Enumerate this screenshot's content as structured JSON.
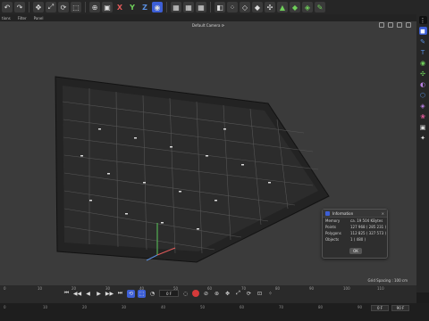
{
  "menubar": {
    "items": [
      "tions",
      "Filter",
      "Panel"
    ]
  },
  "toolbar": {
    "axis_x": "X",
    "axis_y": "Y",
    "axis_z": "Z"
  },
  "viewport": {
    "camera_label": "Default Camera ⟳",
    "grid_spacing": "Grid Spacing : 100 cm"
  },
  "info_dialog": {
    "title": "Information",
    "close": "✕",
    "rows": [
      {
        "key": "Memory",
        "value": "ca. 19 504 KBytes"
      },
      {
        "key": "Points",
        "value": "127 968 ( 285 231 )"
      },
      {
        "key": "Polygons",
        "value": "112 825 ( 327 573 )"
      },
      {
        "key": "Objects",
        "value": "1 ( 480 )"
      }
    ],
    "ok_label": "OK"
  },
  "timeline": {
    "ruler_labels": [
      "0",
      "10",
      "20",
      "30",
      "40",
      "50",
      "60",
      "70",
      "80",
      "90",
      "100",
      "110"
    ],
    "current_frame": "0 F",
    "bottom_ruler": [
      "0",
      "10",
      "20",
      "30",
      "40",
      "50",
      "60",
      "70",
      "80",
      "90"
    ],
    "start_frame": "0 F",
    "end_frame": "90 F"
  },
  "colors": {
    "accent": "#3d5fd6",
    "record": "#d53a3a",
    "viewport_bg": "#3b3b3b"
  }
}
